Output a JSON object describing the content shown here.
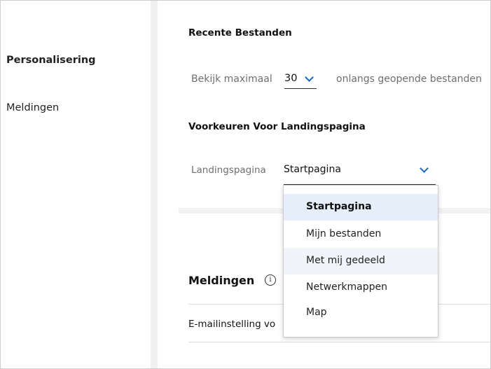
{
  "sidebar": {
    "items": [
      {
        "label": "Personalisering",
        "active": true
      },
      {
        "label": "Meldingen",
        "active": false
      }
    ]
  },
  "recent_files": {
    "heading": "Recente Bestanden",
    "prefix": "Bekijk maximaal",
    "value": "30",
    "suffix": "onlangs geopende bestanden"
  },
  "landing": {
    "heading": "Voorkeuren Voor Landingspagina",
    "label": "Landingspagina",
    "value": "Startpagina",
    "options": [
      "Startpagina",
      "Mijn bestanden",
      "Met mij gedeeld",
      "Netwerkmappen",
      "Map"
    ],
    "selected_index": 0,
    "hover_index": 2
  },
  "notifications": {
    "heading": "Meldingen",
    "info_icon": "info-icon",
    "email_label": "E-mailinstelling vo"
  },
  "colors": {
    "accent": "#1a65c9",
    "selected_bg": "#e6eef9"
  }
}
